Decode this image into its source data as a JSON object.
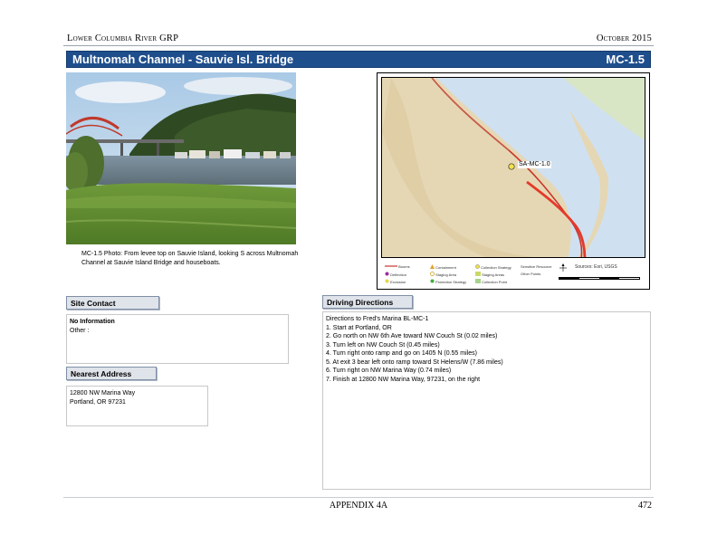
{
  "header": {
    "left": "Lower Columbia River GRP",
    "right": "October 2015"
  },
  "title": {
    "name": "Multnomah Channel - Sauvie Isl. Bridge",
    "code": "MC-1.5"
  },
  "photo": {
    "caption": "MC-1.5 Photo: From levee top on Sauvie Island, looking S across Multnomah Channel at Sauvie Island Bridge and houseboats."
  },
  "map": {
    "site_label": "SA-MC-1.0",
    "legend": {
      "items": [
        "Booms",
        "Deflection",
        "Exclusion",
        "Containment",
        "Staging Area",
        "Protection Strategy",
        "Collection Strategy",
        "Staging Areas",
        "Collection Point",
        "Sensitive Resource",
        "Other Points"
      ],
      "source": "Sources: Esri, USGS"
    }
  },
  "site_contact": {
    "label": "Site Contact",
    "name": "No Information",
    "other": "Other :"
  },
  "nearest_address": {
    "label": "Nearest Address",
    "line1": "12800 NW Marina Way",
    "line2": "Portland, OR 97231"
  },
  "driving": {
    "label": "Driving Directions",
    "lines": [
      "Directions to Fred's Marina BL-MC-1",
      "1. Start at Portland, OR",
      "2. Go north on NW 6th Ave toward NW Couch St (0.02 miles)",
      "3. Turn left on NW Couch St (0.45 miles)",
      "4. Turn right onto ramp and go on 1405 N (0.55 miles)",
      "5. At exit 3 bear left onto ramp toward St Helens/W (7.86 miles)",
      "6. Turn right on NW Marina Way (0.74 miles)",
      "7. Finish at 12800 NW Marina Way, 97231, on the right"
    ]
  },
  "footer": {
    "center": "APPENDIX 4A",
    "page": "472"
  }
}
